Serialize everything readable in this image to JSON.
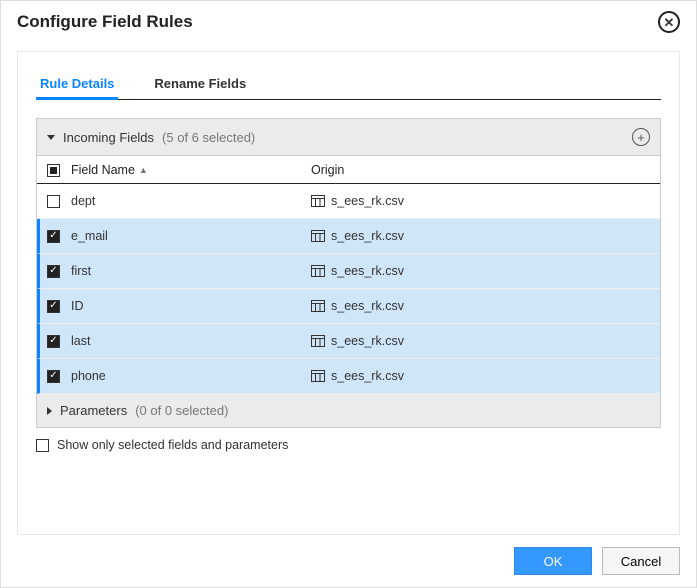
{
  "dialog": {
    "title": "Configure Field Rules"
  },
  "tabs": [
    {
      "label": "Rule Details",
      "active": true
    },
    {
      "label": "Rename Fields",
      "active": false
    }
  ],
  "incoming": {
    "heading": "Incoming Fields",
    "count_text": "(5 of 6 selected)",
    "columns": {
      "check": "",
      "name": "Field Name",
      "origin": "Origin"
    },
    "rows": [
      {
        "checked": false,
        "name": "dept",
        "origin": "s_ees_rk.csv"
      },
      {
        "checked": true,
        "name": "e_mail",
        "origin": "s_ees_rk.csv"
      },
      {
        "checked": true,
        "name": "first",
        "origin": "s_ees_rk.csv"
      },
      {
        "checked": true,
        "name": "ID",
        "origin": "s_ees_rk.csv"
      },
      {
        "checked": true,
        "name": "last",
        "origin": "s_ees_rk.csv"
      },
      {
        "checked": true,
        "name": "phone",
        "origin": "s_ees_rk.csv"
      }
    ]
  },
  "parameters": {
    "heading": "Parameters",
    "count_text": "(0 of 0 selected)"
  },
  "filter": {
    "label": "Show only selected fields and parameters",
    "checked": false
  },
  "buttons": {
    "ok": "OK",
    "cancel": "Cancel"
  }
}
